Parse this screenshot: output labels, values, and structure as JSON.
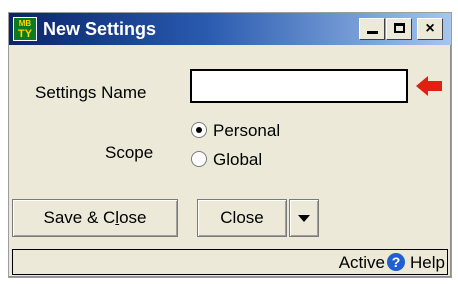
{
  "window": {
    "title": "New Settings",
    "app_icon_top": "MB",
    "app_icon_bottom": "TY",
    "controls": {
      "minimize": "minimize",
      "maximize": "maximize",
      "close": "×"
    }
  },
  "form": {
    "name_label": "Settings Name",
    "name_value": "",
    "scope_label": "Scope",
    "scope_options": [
      {
        "label": "Personal",
        "selected": true
      },
      {
        "label": "Global",
        "selected": false
      }
    ]
  },
  "buttons": {
    "save_close_prefix": "Save & C",
    "save_close_mnemonic": "l",
    "save_close_suffix": "ose",
    "close": "Close"
  },
  "status": {
    "state": "Active",
    "help": "Help"
  },
  "colors": {
    "title_start": "#0a246a",
    "title_end": "#a6c6ee",
    "arrow": "#e02010",
    "window_bg": "#ece9d8"
  }
}
